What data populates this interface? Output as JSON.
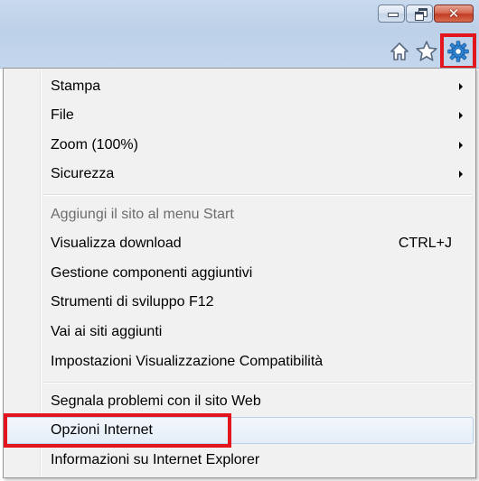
{
  "window": {
    "caption_buttons": [
      {
        "name": "minimize",
        "icon": "minimize-icon"
      },
      {
        "name": "restore",
        "icon": "restore-icon"
      },
      {
        "name": "close",
        "icon": "close-icon",
        "glyph": "✕"
      }
    ],
    "toolbar_icons": [
      "home-icon",
      "favorites-star-icon",
      "tools-gear-icon"
    ]
  },
  "menu": {
    "groups": [
      [
        {
          "label": "Stampa",
          "submenu": true
        },
        {
          "label": "File",
          "submenu": true
        },
        {
          "label": "Zoom (100%)",
          "submenu": true
        },
        {
          "label": "Sicurezza",
          "submenu": true
        }
      ],
      [
        {
          "label": "Aggiungi il sito al menu Start",
          "disabled": true
        },
        {
          "label": "Visualizza download",
          "shortcut": "CTRL+J"
        },
        {
          "label": "Gestione componenti aggiuntivi"
        },
        {
          "label": "Strumenti di sviluppo F12"
        },
        {
          "label": "Vai ai siti aggiunti"
        },
        {
          "label": "Impostazioni Visualizzazione Compatibilità"
        }
      ],
      [
        {
          "label": "Segnala problemi con il sito Web"
        },
        {
          "label": "Opzioni Internet",
          "highlighted": true
        },
        {
          "label": "Informazioni su Internet Explorer"
        }
      ]
    ]
  },
  "colors": {
    "highlight_red": "#e2161c",
    "menu_background": "#f1f1f1",
    "disabled_text": "#6d6d6d"
  }
}
